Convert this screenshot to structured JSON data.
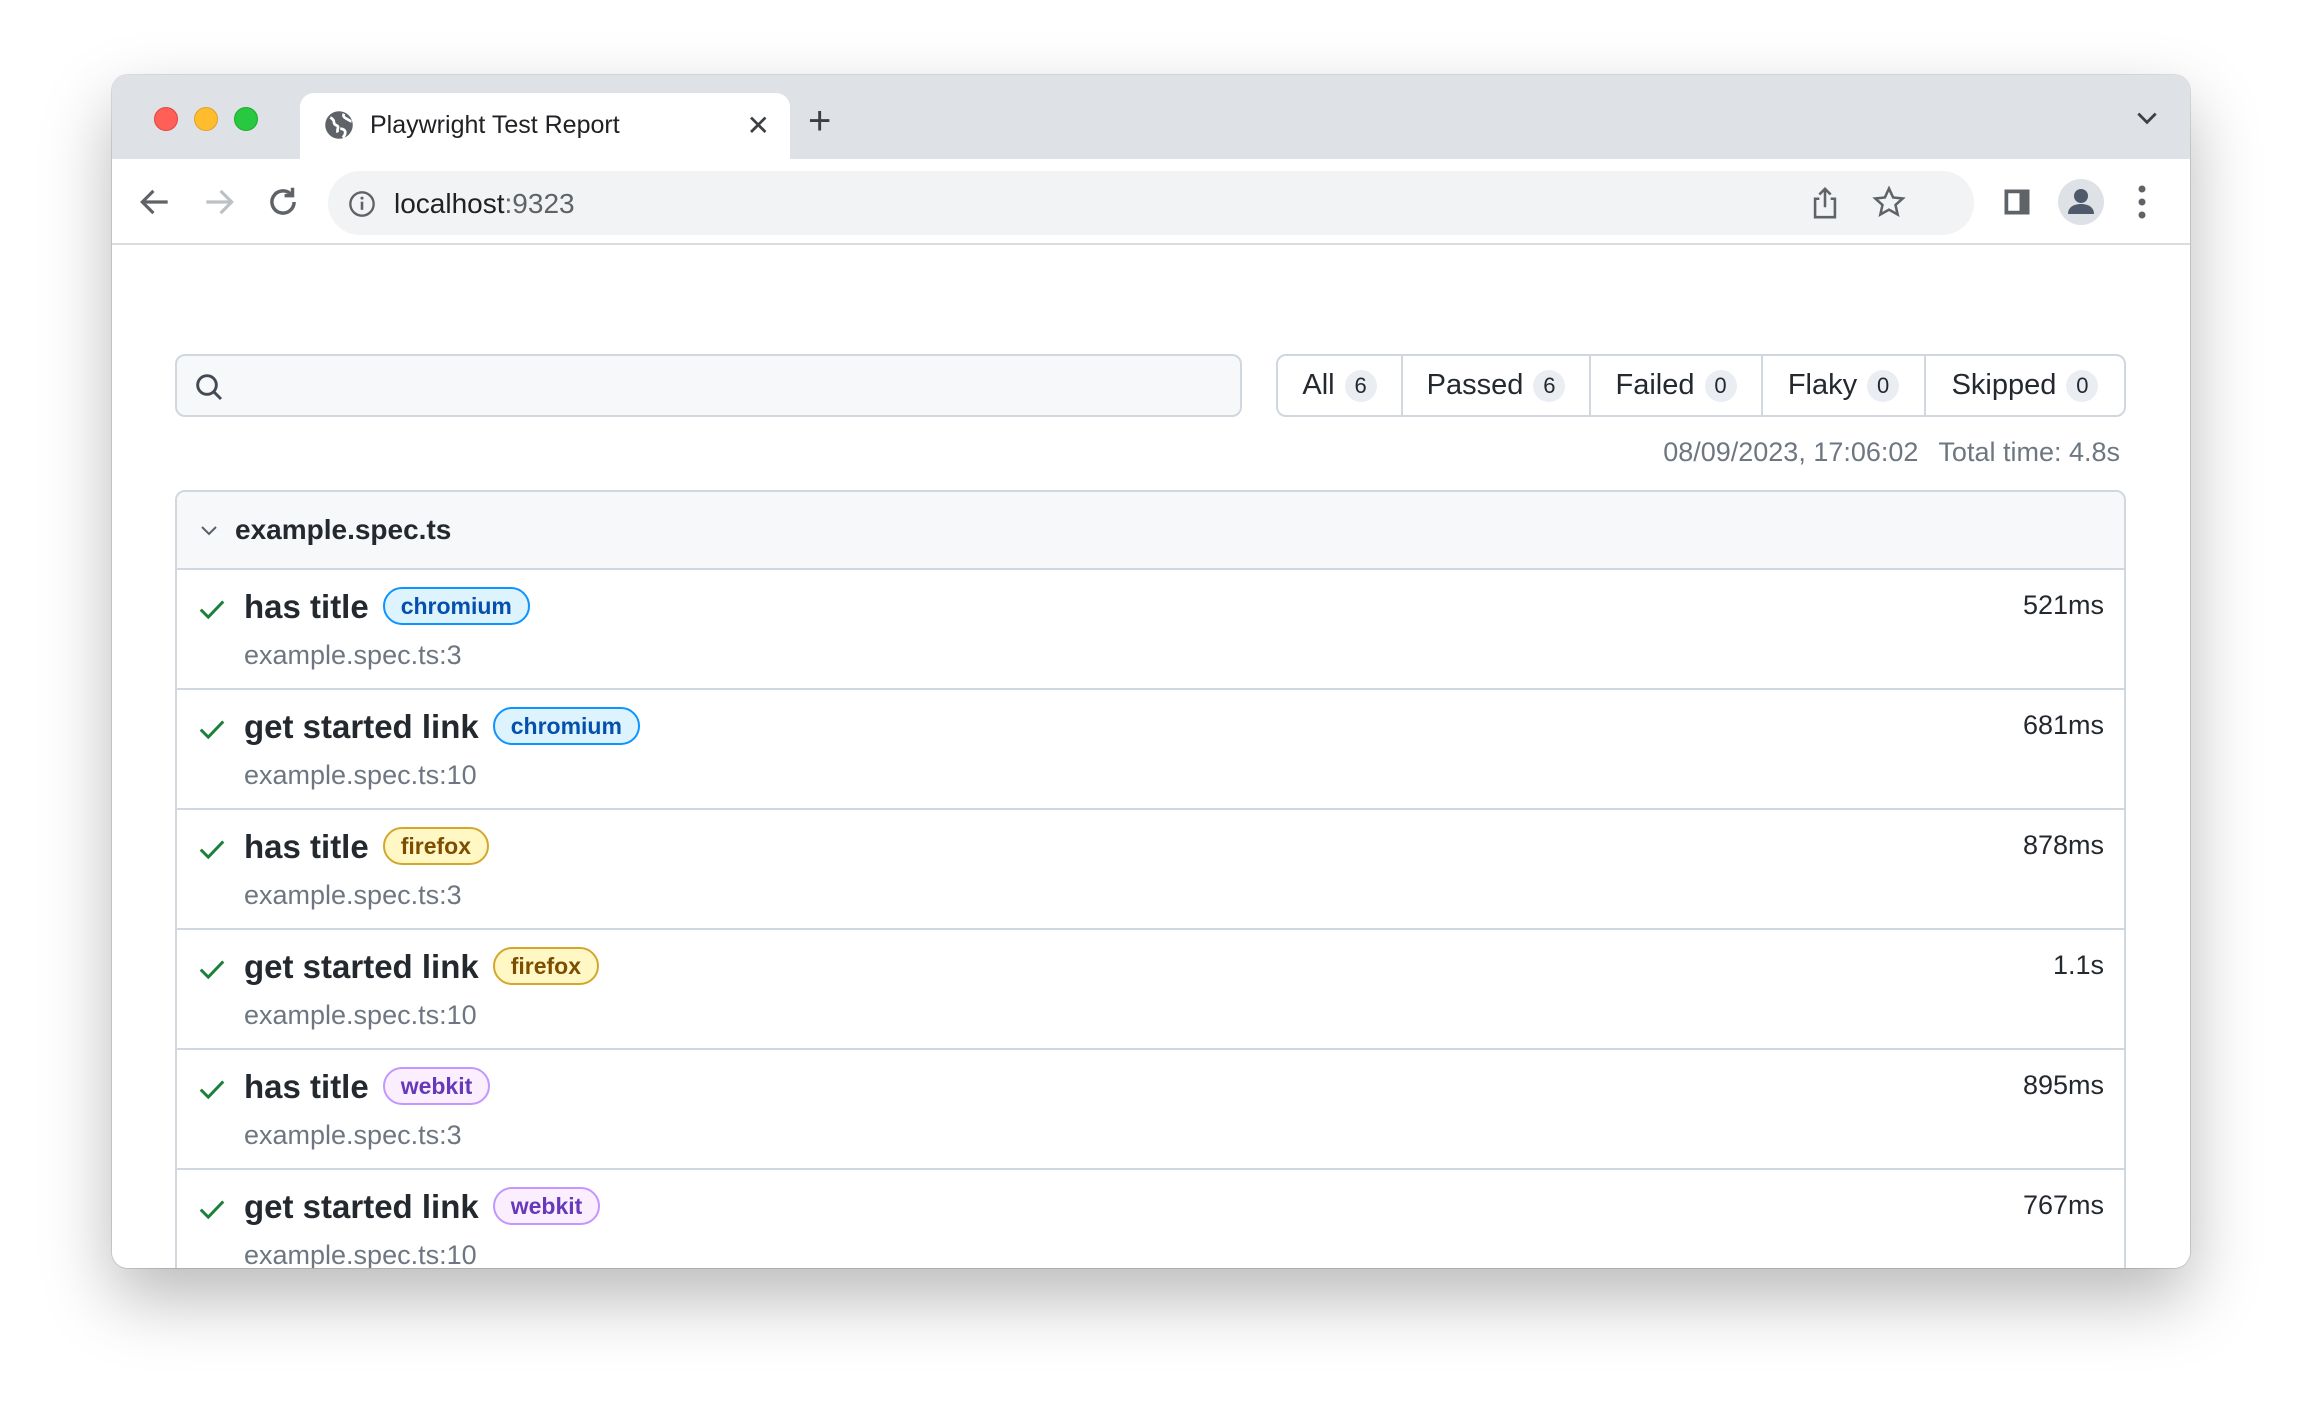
{
  "browser": {
    "tab_title": "Playwright Test Report",
    "url_host": "localhost",
    "url_port": ":9323"
  },
  "search": {
    "placeholder": "",
    "value": ""
  },
  "filters": [
    {
      "label": "All",
      "count": "6"
    },
    {
      "label": "Passed",
      "count": "6"
    },
    {
      "label": "Failed",
      "count": "0"
    },
    {
      "label": "Flaky",
      "count": "0"
    },
    {
      "label": "Skipped",
      "count": "0"
    }
  ],
  "meta": {
    "timestamp": "08/09/2023, 17:06:02",
    "total_time": "Total time: 4.8s"
  },
  "group": {
    "title": "example.spec.ts",
    "tests": [
      {
        "title": "has title",
        "project": "chromium",
        "location": "example.spec.ts:3",
        "duration": "521ms",
        "status": "passed"
      },
      {
        "title": "get started link",
        "project": "chromium",
        "location": "example.spec.ts:10",
        "duration": "681ms",
        "status": "passed"
      },
      {
        "title": "has title",
        "project": "firefox",
        "location": "example.spec.ts:3",
        "duration": "878ms",
        "status": "passed"
      },
      {
        "title": "get started link",
        "project": "firefox",
        "location": "example.spec.ts:10",
        "duration": "1.1s",
        "status": "passed"
      },
      {
        "title": "has title",
        "project": "webkit",
        "location": "example.spec.ts:3",
        "duration": "895ms",
        "status": "passed"
      },
      {
        "title": "get started link",
        "project": "webkit",
        "location": "example.spec.ts:10",
        "duration": "767ms",
        "status": "passed"
      }
    ]
  },
  "colors": {
    "passed": "#1a7f37",
    "chromium": {
      "bg": "#ddf4ff",
      "border": "#0e94ff",
      "text": "#0550ae"
    },
    "firefox": {
      "bg": "#fff8c5",
      "border": "#d4a72c",
      "text": "#7d4e00"
    },
    "webkit": {
      "bg": "#fbefff",
      "border": "#c297ff",
      "text": "#6639ba"
    }
  }
}
